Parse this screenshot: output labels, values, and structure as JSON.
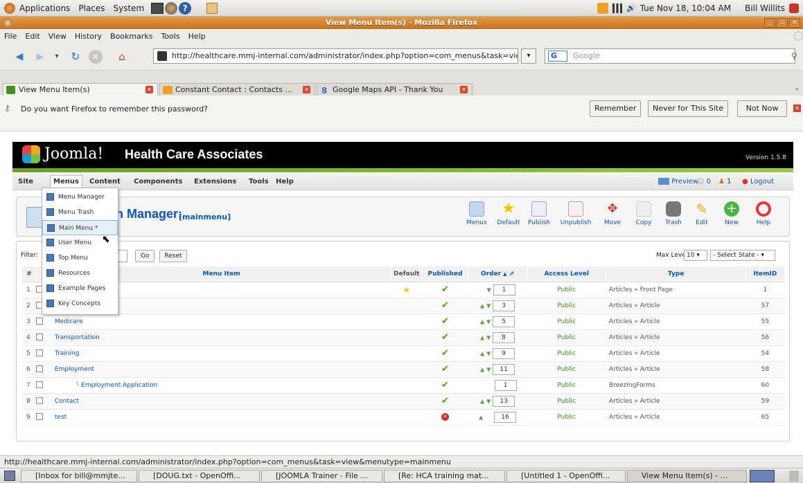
{
  "gnome": {
    "menus": [
      "Applications",
      "Places",
      "System"
    ],
    "clock": "Tue Nov 18, 10:04 AM",
    "user": "Bill Willits"
  },
  "window": {
    "title": "View Menu Item(s) - Mozilla Firefox"
  },
  "menubar": [
    "File",
    "Edit",
    "View",
    "History",
    "Bookmarks",
    "Tools",
    "Help"
  ],
  "nav": {
    "url": "http://healthcare.mmj-internal.com/administrator/index.php?option=com_menus&task=view&menutype=mainr",
    "search_placeholder": "Google",
    "search_engine": "G"
  },
  "tabs": [
    {
      "label": "View Menu Item(s)"
    },
    {
      "label": "Constant Contact : Contacts ..."
    },
    {
      "label": "Google Maps API - Thank You"
    }
  ],
  "password_bar": {
    "message": "Do you want Firefox to remember this password?",
    "remember": "Remember",
    "never": "Never for This Site",
    "not_now": "Not Now"
  },
  "joomla": {
    "logo": "Joomla!",
    "site_name": "Health Care Associates",
    "version": "Version 1.5.8",
    "menu": [
      "Site",
      "Menus",
      "Content",
      "Components",
      "Extensions",
      "Tools",
      "Help"
    ],
    "header_right": {
      "preview": "Preview",
      "messages": "0",
      "users": "1",
      "logout": "Logout"
    },
    "page_title": "n Manager:",
    "page_subtitle": "[mainmenu]",
    "toolbar": [
      "Menus",
      "Default",
      "Publish",
      "Unpublish",
      "Move",
      "Copy",
      "Trash",
      "Edit",
      "New",
      "Help"
    ],
    "filter": {
      "label": "Filter:",
      "go": "Go",
      "reset": "Reset",
      "max_levels_label": "Max Levels",
      "max_levels_value": "10",
      "state": "- Select State -"
    },
    "columns": [
      "#",
      "Menu Item",
      "Default",
      "Published",
      "Order",
      "Access Level",
      "Type",
      "ItemID"
    ],
    "rows": [
      {
        "num": "1",
        "name": "",
        "default": true,
        "published": "yes",
        "order": "1",
        "access": "Public",
        "type": "Articles » Front Page",
        "id": "1"
      },
      {
        "num": "2",
        "name": "",
        "default": false,
        "published": "yes",
        "order": "3",
        "access": "Public",
        "type": "Articles » Article",
        "id": "57"
      },
      {
        "num": "3",
        "name": "Medicare",
        "default": false,
        "published": "yes",
        "order": "5",
        "access": "Public",
        "type": "Articles » Article",
        "id": "55"
      },
      {
        "num": "4",
        "name": "Transportation",
        "default": false,
        "published": "yes",
        "order": "8",
        "access": "Public",
        "type": "Articles » Article",
        "id": "56"
      },
      {
        "num": "5",
        "name": "Training",
        "default": false,
        "published": "yes",
        "order": "9",
        "access": "Public",
        "type": "Articles » Article",
        "id": "54"
      },
      {
        "num": "6",
        "name": "Employment",
        "default": false,
        "published": "yes",
        "order": "11",
        "access": "Public",
        "type": "Articles » Article",
        "id": "58"
      },
      {
        "num": "7",
        "name": "Employment Application",
        "default": false,
        "published": "yes",
        "order": "1",
        "access": "Public",
        "type": "BreezingForms",
        "id": "60"
      },
      {
        "num": "8",
        "name": "Contact",
        "default": false,
        "published": "yes",
        "order": "13",
        "access": "Public",
        "type": "Articles » Article",
        "id": "59"
      },
      {
        "num": "9",
        "name": "test",
        "default": false,
        "published": "no",
        "order": "16",
        "access": "Public",
        "type": "Articles » Article",
        "id": "65"
      }
    ],
    "dropdown": [
      "Menu Manager",
      "Menu Trash",
      "Main Menu *",
      "User Menu",
      "Top Menu",
      "Resources",
      "Example Pages",
      "Key Concepts"
    ]
  },
  "statusbar": "http://healthcare.mmj-internal.com/administrator/index.php?option=com_menus&task=view&menutype=mainmenu",
  "taskbar": [
    "[Inbox for bill@mmjte...",
    "[DOUG.txt - OpenOffi...",
    "[JOOMLA Trainer - File ...",
    "[Re: HCA training mat...",
    "[Untitled 1 - OpenOffi...",
    "View Menu Item(s) - ..."
  ]
}
